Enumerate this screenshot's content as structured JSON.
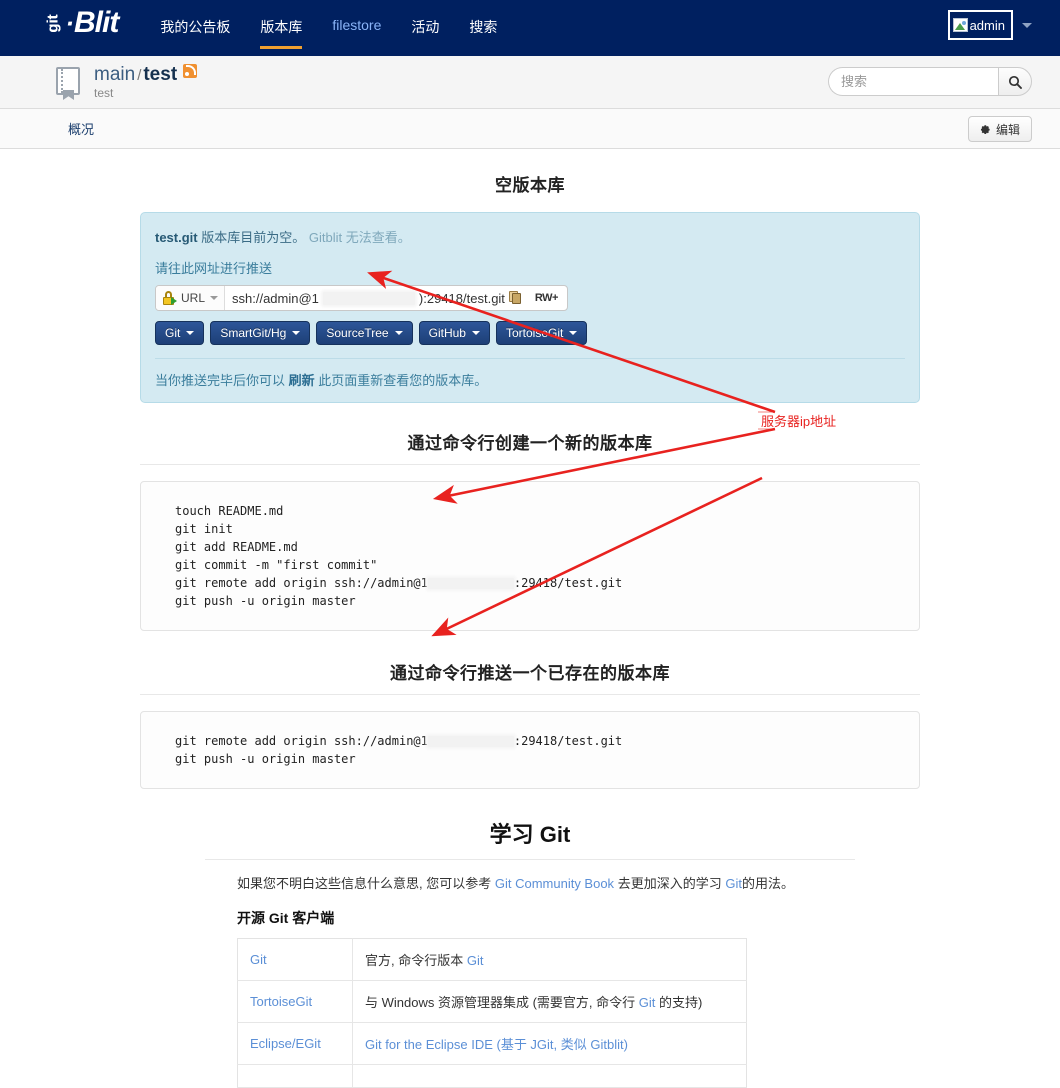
{
  "nav": {
    "logo_git": "git",
    "logo_text": "Blit",
    "links": [
      {
        "label": "我的公告板",
        "active": false,
        "alt": false
      },
      {
        "label": "版本库",
        "active": true,
        "alt": false
      },
      {
        "label": "filestore",
        "active": false,
        "alt": true
      },
      {
        "label": "活动",
        "active": false,
        "alt": false
      },
      {
        "label": "搜索",
        "active": false,
        "alt": false
      }
    ],
    "user": "admin"
  },
  "repo": {
    "project": "main",
    "separator": "/",
    "name": "test",
    "description": "test"
  },
  "search": {
    "placeholder": "搜索",
    "value": ""
  },
  "tabs": {
    "overview": "概况",
    "edit": "编辑"
  },
  "empty_repo": {
    "heading": "空版本库",
    "repo_file": "test.git",
    "line1_rest": "版本库目前为空。",
    "line1_muted": "Gitblit 无法查看。",
    "push_prompt": "请往此网址进行推送",
    "url_kind": "URL",
    "url_prefix": "ssh://admin@1",
    "url_suffix": "):29418/test.git",
    "access": "RW+",
    "clients": [
      "Git",
      "SmartGit/Hg",
      "SourceTree",
      "GitHub",
      "TortoiseGit"
    ],
    "footer_pre": "当你推送完毕后你可以",
    "footer_link": "刷新",
    "footer_post": "此页面重新查看您的版本库。"
  },
  "create_section": {
    "heading": "通过命令行创建一个新的版本库",
    "lines": [
      "touch README.md",
      "git init",
      "git add README.md",
      "git commit -m \"first commit\"",
      "git remote add origin ssh://admin@1             :29418/test.git",
      "git push -u origin master"
    ]
  },
  "push_section": {
    "heading": "通过命令行推送一个已存在的版本库",
    "lines": [
      "git remote add origin ssh://admin@1             :29418/test.git",
      "git push -u origin master"
    ]
  },
  "learn": {
    "heading": "学习 Git",
    "para_pre": "如果您不明白这些信息什么意思, 您可以参考",
    "para_link": "Git Community Book",
    "para_mid": "去更加深入的学习",
    "para_git": "Git",
    "para_post": "的用法。",
    "sub_heading": "开源 Git 客户端",
    "rows": [
      {
        "name": "Git",
        "desc_pre": "官方, 命令行版本",
        "desc_git": "Git",
        "desc_post": ""
      },
      {
        "name": "TortoiseGit",
        "desc_pre": "与 Windows 资源管理器集成 (需要官方, 命令行",
        "desc_git": "Git",
        "desc_post": "的支持)"
      },
      {
        "name": "Eclipse/EGit",
        "desc_pre": "Git for the Eclipse IDE (基于 JGit, 类似 Gitblit)",
        "desc_git": "",
        "desc_post": ""
      }
    ]
  },
  "annotation": {
    "label": "服务器ip地址",
    "color": "#e8221f"
  }
}
